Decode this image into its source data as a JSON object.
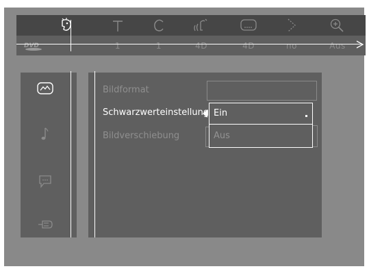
{
  "top_menu": {
    "icons": [
      {
        "name": "picture-settings-icon",
        "value": ""
      },
      {
        "name": "subtitle-icon",
        "value": "1"
      },
      {
        "name": "chapter-icon",
        "value": "1"
      },
      {
        "name": "audio-icon",
        "value": "4D"
      },
      {
        "name": "audio-language-icon",
        "value": "4D"
      },
      {
        "name": "angle-icon",
        "value": "no"
      },
      {
        "name": "zoom-icon",
        "value": "Aus"
      }
    ],
    "disc_type": "DVD"
  },
  "side_menu": {
    "items": [
      {
        "name": "picture-icon",
        "selected": true
      },
      {
        "name": "sound-icon",
        "selected": false
      },
      {
        "name": "language-icon",
        "selected": false
      },
      {
        "name": "features-icon",
        "selected": false
      }
    ]
  },
  "settings": {
    "rows": [
      {
        "label": "Bildformat",
        "active": false
      },
      {
        "label": "Schwarzwerteinstellung",
        "active": true
      },
      {
        "label": "Bildverschiebung",
        "active": false
      }
    ]
  },
  "dropdown": {
    "options": [
      "Ein",
      "Aus"
    ],
    "selected": "Ein"
  },
  "colors": {
    "screen_bg": "#898989",
    "panel_bg": "#5f5f5f",
    "iconbar_bg": "#464646",
    "active_text": "#ffffff",
    "inactive_text": "#8f8f8f"
  }
}
